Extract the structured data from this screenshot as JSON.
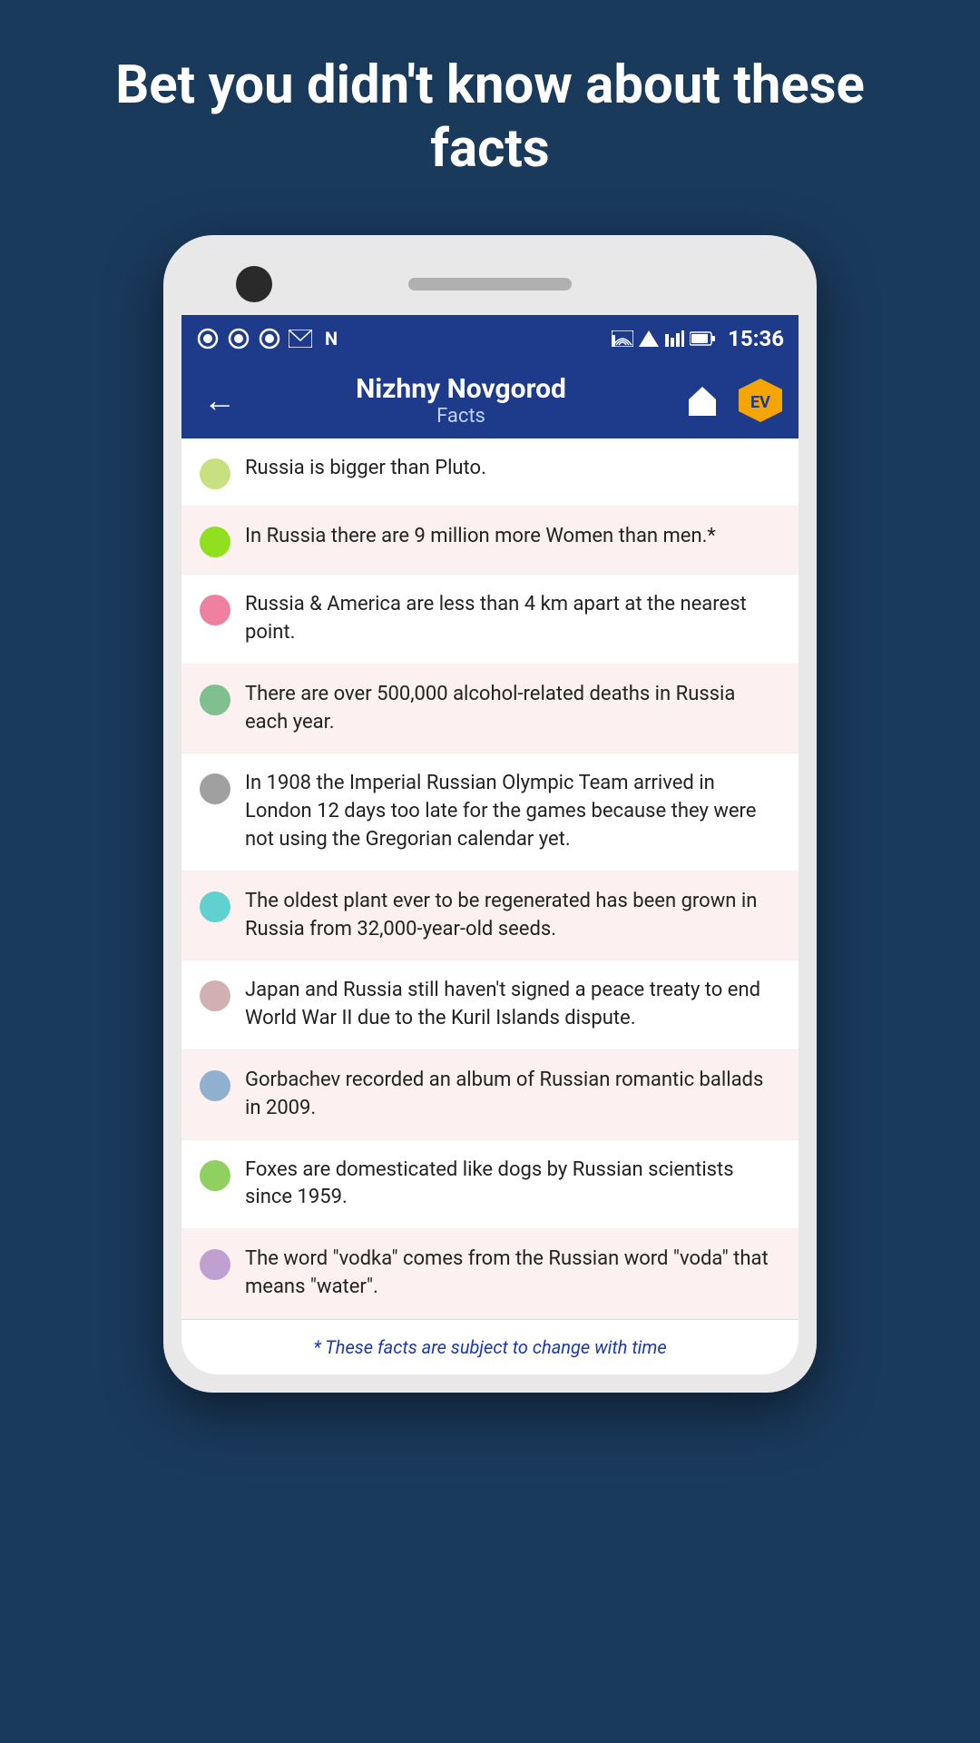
{
  "headline": "Bet you didn't know about these facts",
  "status_bar": {
    "time": "15:36",
    "icons_left": [
      "shutter1",
      "shutter2",
      "shutter3",
      "gmail",
      "nfc"
    ],
    "icons_right": [
      "cast",
      "wifi",
      "signal1",
      "signal2",
      "battery"
    ]
  },
  "app_bar": {
    "title": "Nizhny Novgorod",
    "subtitle": "Facts",
    "back_label": "←",
    "home_icon": "home",
    "badge_label": "EV"
  },
  "facts": [
    {
      "id": 1,
      "dot_color": "#c8e080",
      "text": "Russia is bigger than Pluto."
    },
    {
      "id": 2,
      "dot_color": "#90e020",
      "text": "In Russia there are 9 million more Women than men.*"
    },
    {
      "id": 3,
      "dot_color": "#f080a0",
      "text": "Russia & America are less than 4 km apart at the nearest point."
    },
    {
      "id": 4,
      "dot_color": "#80c090",
      "text": "There are over 500,000 alcohol-related deaths in Russia each year."
    },
    {
      "id": 5,
      "dot_color": "#a0a0a0",
      "text": "In 1908 the Imperial Russian Olympic Team arrived in London 12 days too late for the games because they were not using the Gregorian calendar yet."
    },
    {
      "id": 6,
      "dot_color": "#60d0d0",
      "text": "The oldest plant ever to be regenerated has been grown in Russia from 32,000-year-old seeds."
    },
    {
      "id": 7,
      "dot_color": "#d0b0b0",
      "text": "Japan and Russia still haven't signed a peace treaty to end World War II due to the Kuril Islands dispute."
    },
    {
      "id": 8,
      "dot_color": "#90b0d0",
      "text": "Gorbachev recorded an album of Russian romantic ballads in 2009."
    },
    {
      "id": 9,
      "dot_color": "#90d060",
      "text": "Foxes are domesticated like dogs by Russian scientists since 1959."
    },
    {
      "id": 10,
      "dot_color": "#c0a0d0",
      "text": "The word \"vodka\" comes from the Russian word \"voda\" that means \"water\"."
    }
  ],
  "footnote": "* These facts are subject to change with time"
}
